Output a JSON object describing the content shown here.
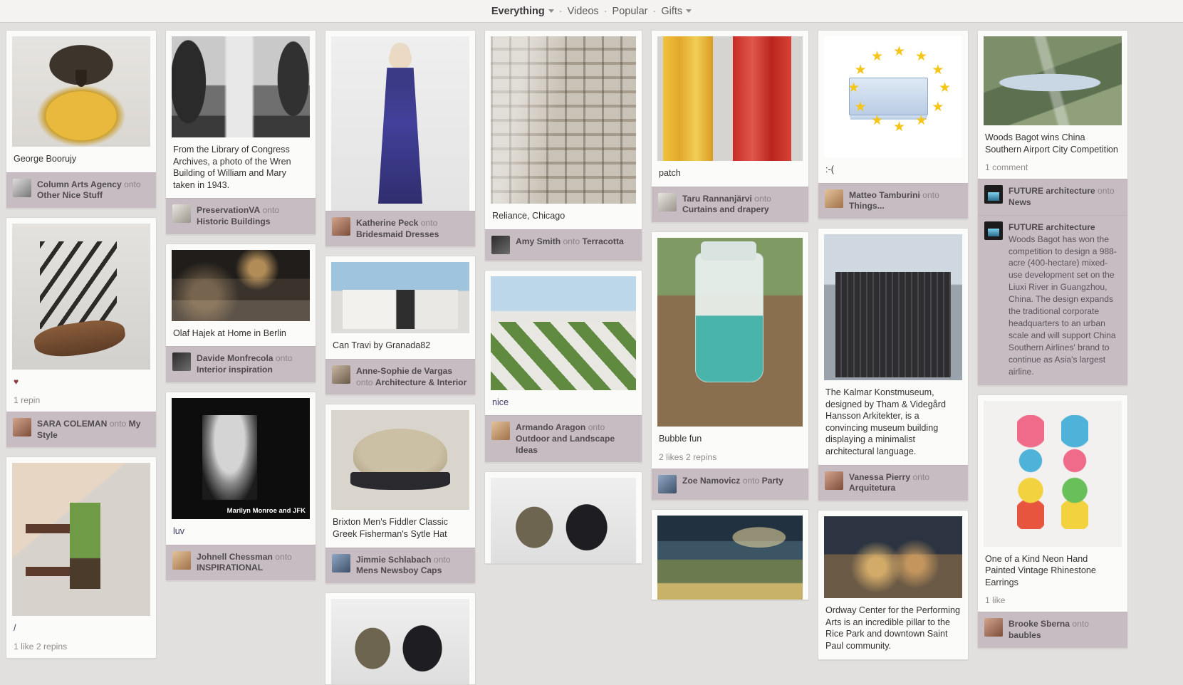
{
  "header": {
    "nav": [
      {
        "label": "Everything",
        "caret": true,
        "active": true,
        "name": "nav-everything"
      },
      {
        "label": "Videos",
        "caret": false,
        "active": false,
        "name": "nav-videos"
      },
      {
        "label": "Popular",
        "caret": false,
        "active": false,
        "name": "nav-popular"
      },
      {
        "label": "Gifts",
        "caret": true,
        "active": false,
        "name": "nav-gifts"
      }
    ],
    "separator": "·"
  },
  "icons": {
    "caret_down": "chevron-down-icon",
    "heart": "♥"
  },
  "labels": {
    "onto": "onto"
  },
  "columns": [
    {
      "pins": [
        {
          "art": "art-hawk",
          "caption": "George Boorujy",
          "attrib": {
            "user": "Column Arts Agency",
            "onto": "onto",
            "board": "Other Nice Stuff",
            "avatar": "av-7"
          }
        },
        {
          "art": "art-sandal",
          "caption": "",
          "heart": "♥",
          "meta": "1 repin",
          "attrib": {
            "user": "SARA COLEMAN",
            "onto": "onto",
            "board": "My Style",
            "avatar": "av-3"
          }
        },
        {
          "art": "art-shelf",
          "caption": "/",
          "caption_link": true,
          "meta": "1 like  2 repins"
        }
      ]
    },
    {
      "pins": [
        {
          "art": "art-bw-archive",
          "caption": "From the Library of Congress Archives, a photo of the Wren Building of William and Mary taken in 1943.",
          "attrib": {
            "user": "PreservationVA",
            "onto": "onto",
            "board": "Historic Buildings",
            "avatar": "av-1"
          }
        },
        {
          "art": "art-kitchen",
          "caption": "Olaf Hajek at Home in Berlin",
          "attrib": {
            "user": "Davide Monfrecola",
            "onto": "onto",
            "board": "Interior inspiration",
            "avatar": "av-2"
          }
        },
        {
          "art": "art-marilyn",
          "art_overlay": "Marilyn Monroe and JFK",
          "caption": "luv",
          "caption_link": true,
          "attrib": {
            "user": "Johnell Chessman",
            "onto": "onto",
            "board": "INSPIRATIONAL",
            "avatar": "av-6"
          }
        }
      ]
    },
    {
      "pins": [
        {
          "art": "art-dress",
          "caption": "",
          "attrib": {
            "user": "Katherine Peck",
            "onto": "onto",
            "board": "Bridesmaid Dresses",
            "avatar": "av-3"
          }
        },
        {
          "art": "art-travi",
          "caption": "Can Travi by Granada82",
          "attrib": {
            "user": "Anne-Sophie de Vargas",
            "onto": "onto",
            "board": "Architecture & Interior",
            "avatar": "av-4"
          }
        },
        {
          "art": "art-hat",
          "caption": "Brixton Men's Fiddler Classic Greek Fisherman's Sytle Hat",
          "attrib": {
            "user": "Jimmie Schlabach",
            "onto": "onto",
            "board": "Mens Newsboy Caps",
            "avatar": "av-5"
          }
        },
        {
          "art": "art-bags",
          "caption": ""
        }
      ]
    },
    {
      "pins": [
        {
          "art": "art-reliance",
          "caption": "Reliance, Chicago",
          "attrib": {
            "user": "Amy Smith",
            "onto": "onto",
            "board": "Terracotta",
            "avatar": "av-2"
          }
        },
        {
          "art": "art-garden",
          "caption": "nice",
          "caption_link": true,
          "attrib": {
            "user": "Armando Aragon",
            "onto": "onto",
            "board": "Outdoor and Landscape Ideas",
            "avatar": "av-6"
          }
        },
        {
          "art": "art-bags",
          "caption": ""
        }
      ]
    },
    {
      "pins": [
        {
          "art": "art-drape",
          "caption": "patch",
          "attrib": {
            "user": "Taru Rannanjärvi",
            "onto": "onto",
            "board": "Curtains and drapery",
            "avatar": "av-1"
          }
        },
        {
          "art": "art-bubble",
          "caption": "Bubble fun",
          "meta": "2 likes  2 repins",
          "attrib": {
            "user": "Zoe Namovicz",
            "onto": "onto",
            "board": "Party",
            "avatar": "av-5"
          }
        },
        {
          "art": "art-paint",
          "caption": ""
        }
      ]
    },
    {
      "pins": [
        {
          "art": "art-euro",
          "caption": ":-(",
          "attrib": {
            "user": "Matteo Tamburini",
            "onto": "onto",
            "board": "Things...",
            "avatar": "av-6"
          }
        },
        {
          "art": "art-kalmar",
          "caption": "The Kalmar Konstmuseum, designed by Tham & Videgård Hansson Arkitekter, is a convincing museum building displaying a minimalist architectural language.",
          "attrib": {
            "user": "Vanessa Pierry",
            "onto": "onto",
            "board": "Arquitetura",
            "avatar": "av-3"
          }
        },
        {
          "art": "art-ordway",
          "caption": "Ordway Center for the Performing Arts is an incredible pillar to the Rice Park and downtown Saint Paul community."
        }
      ]
    },
    {
      "pins": [
        {
          "art": "art-aerial",
          "caption": "Woods Bagot wins China Southern Airport City Competition",
          "meta": "1 comment",
          "attrib": {
            "user": "FUTURE architecture",
            "onto": "onto",
            "board": "News",
            "avatar": "av-logo"
          },
          "comment": {
            "user": "FUTURE architecture",
            "avatar": "av-logo",
            "text": "Woods Bagot has won the competition to design a 988-acre (400-hectare) mixed-use development set on the Liuxi River in Guangzhou, China. The design expands the traditional corporate headquarters to an urban scale and will support China Southern Airlines' brand to continue as Asia's largest airline."
          }
        },
        {
          "art": "art-earrings",
          "caption": "One of a Kind Neon Hand Painted Vintage Rhinestone Earrings",
          "meta": "1 like",
          "attrib": {
            "user": "Brooke Sberna",
            "onto": "onto",
            "board": "baubles",
            "avatar": "av-3"
          }
        }
      ]
    }
  ]
}
